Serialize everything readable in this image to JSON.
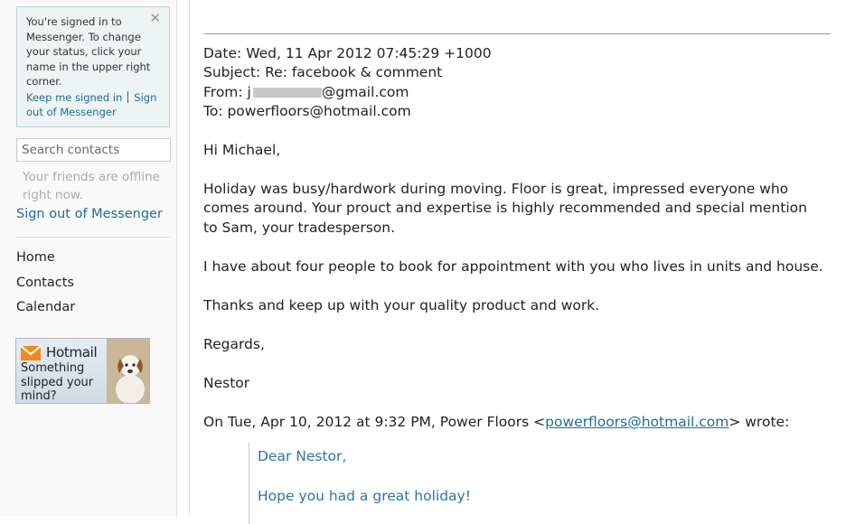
{
  "sidebar": {
    "notice": {
      "text_lines": [
        "You're signed in to",
        "Messenger. To change",
        "your status, click your",
        "name in the upper right",
        "corner."
      ],
      "keep_signed_in": "Keep me signed in",
      "sign_out_link_1": "Sign",
      "sign_out_link_2": "out of Messenger",
      "close_glyph": "✕"
    },
    "search_placeholder": "Search contacts",
    "offline_text_1": "Your friends are offline",
    "offline_text_2": "right now.",
    "sign_out_label": "Sign out of Messenger",
    "nav": [
      "Home",
      "Contacts",
      "Calendar"
    ],
    "ad": {
      "brand": "Hotmail",
      "message": [
        "Something",
        "slipped your",
        "mind?"
      ]
    }
  },
  "email": {
    "date_line": "Date: Wed, 11 Apr 2012 07:45:29 +1000",
    "subject_line": "Subject: Re: facebook & comment",
    "from_prefix": "From: j",
    "from_suffix": "@gmail.com",
    "to_line": "To: powerfloors@hotmail.com",
    "greeting": "Hi Michael,",
    "para1_lines": [
      "Holiday was busy/hardwork during moving. Floor is great, impressed everyone who",
      "comes around. Your prouct and expertise is highly recommended  and special mention",
      "to Sam, your tradesperson."
    ],
    "para2": "I have about four people to book for appointment with you who lives in units and house.",
    "para3": "Thanks and keep up with your quality product and work.",
    "closing": "Regards,",
    "signature": "Nestor",
    "reply_prefix": "On Tue, Apr 10, 2012 at 9:32 PM, Power Floors <",
    "reply_email": "powerfloors@hotmail.com",
    "reply_suffix": "> wrote:",
    "quoted": [
      "Dear Nestor,",
      "Hope you had a great holiday!"
    ]
  },
  "colors": {
    "link": "#1f6c9a",
    "quote_text": "#2e72a8",
    "sidebar_bg": "#f9f9f9",
    "notice_bg": "#eef3f3"
  }
}
